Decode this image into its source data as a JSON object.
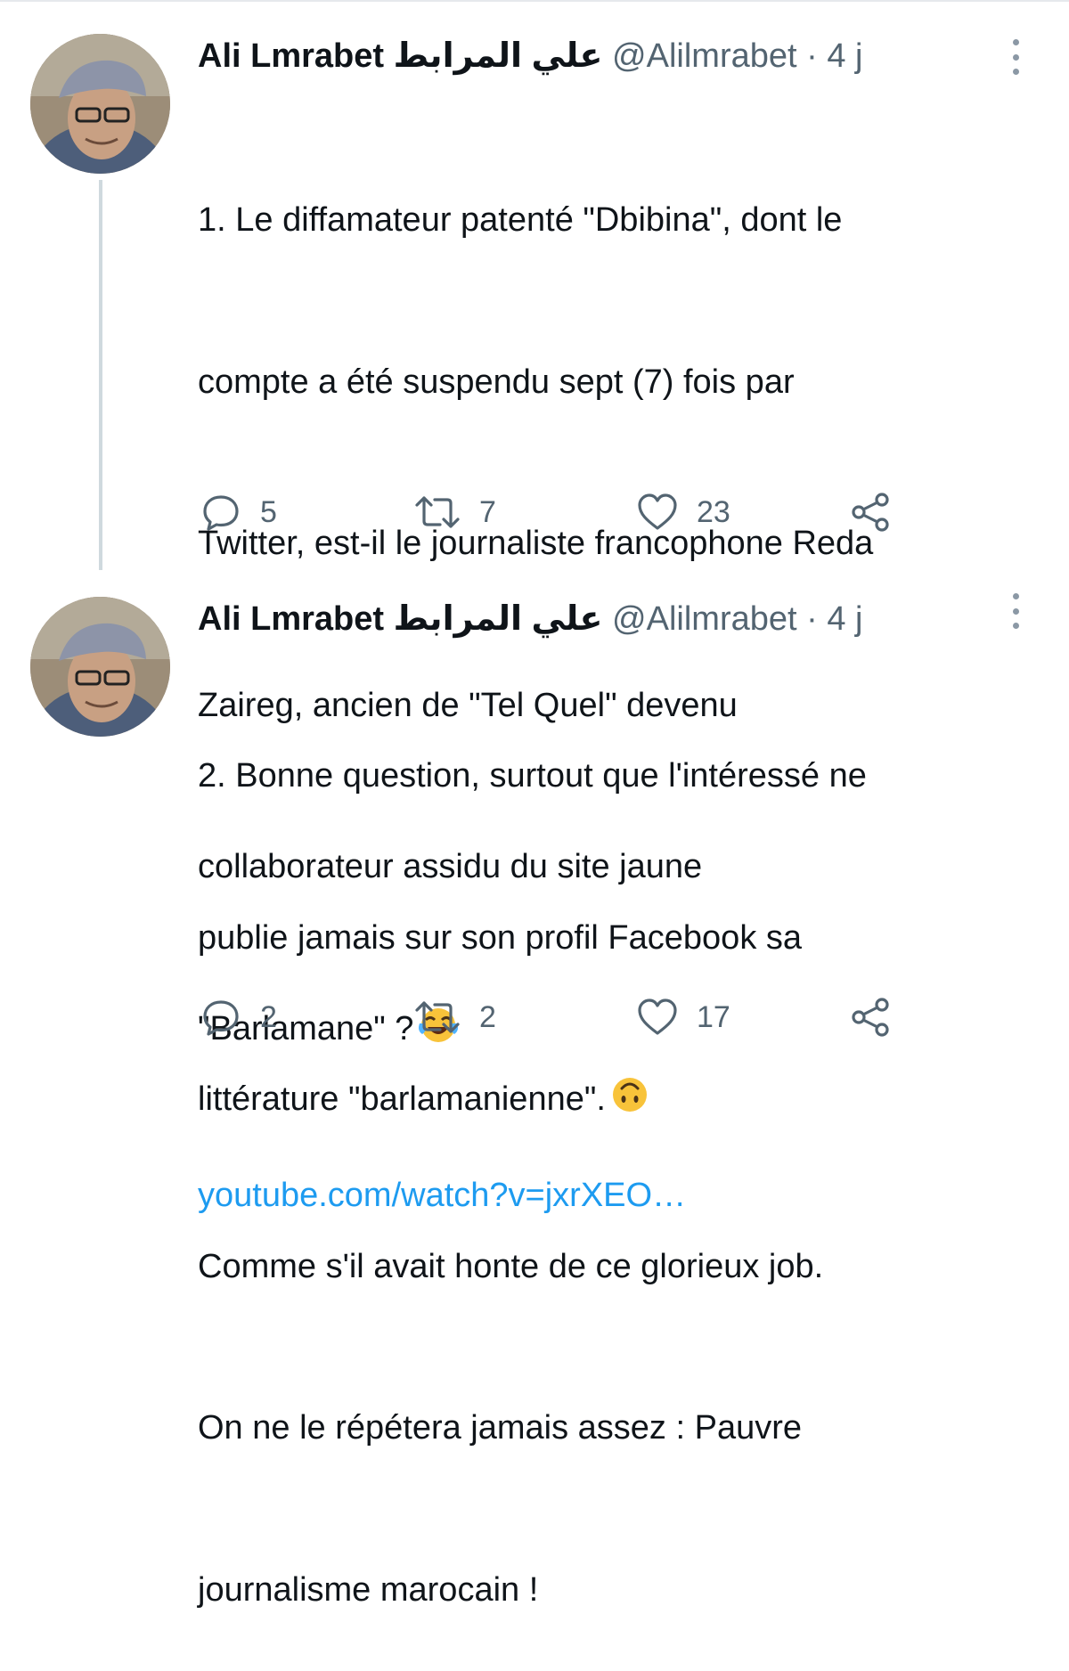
{
  "tweets": [
    {
      "author_name": "Ali Lmrabet",
      "author_name_arabic": "علي المرابط",
      "handle": "@Alilmrabet",
      "separator": "·",
      "time": "4 j",
      "text_lines": [
        "1. Le diffamateur patenté \"Dbibina\", dont le",
        "compte a été suspendu sept (7) fois par",
        "Twitter, est-il le journaliste francophone Reda",
        "Zaireg, ancien de \"Tel Quel\" devenu",
        "collaborateur assidu du site jaune",
        "\"Barlamane\" ?"
      ],
      "emoji": "face-with-tears-of-joy",
      "link": "youtube.com/watch?v=jxrXEO…",
      "replies": "5",
      "retweets": "7",
      "likes": "23"
    },
    {
      "author_name": "Ali Lmrabet",
      "author_name_arabic": "علي المرابط",
      "handle": "@Alilmrabet",
      "separator": "·",
      "time": "4 j",
      "text_lines": [
        "2. Bonne question, surtout que l'intéressé ne",
        "publie jamais sur son profil Facebook sa",
        "littérature \"barlamanienne\".",
        "Comme s'il avait honte de ce glorieux job.",
        "On ne le répétera jamais assez : Pauvre",
        "journalisme marocain !"
      ],
      "emoji": "upside-down-face",
      "replies": "2",
      "retweets": "2",
      "likes": "17"
    }
  ],
  "colors": {
    "text": "#0f1419",
    "secondary": "#536471",
    "link": "#1d9bf0",
    "thread_line": "#cfd9de"
  }
}
